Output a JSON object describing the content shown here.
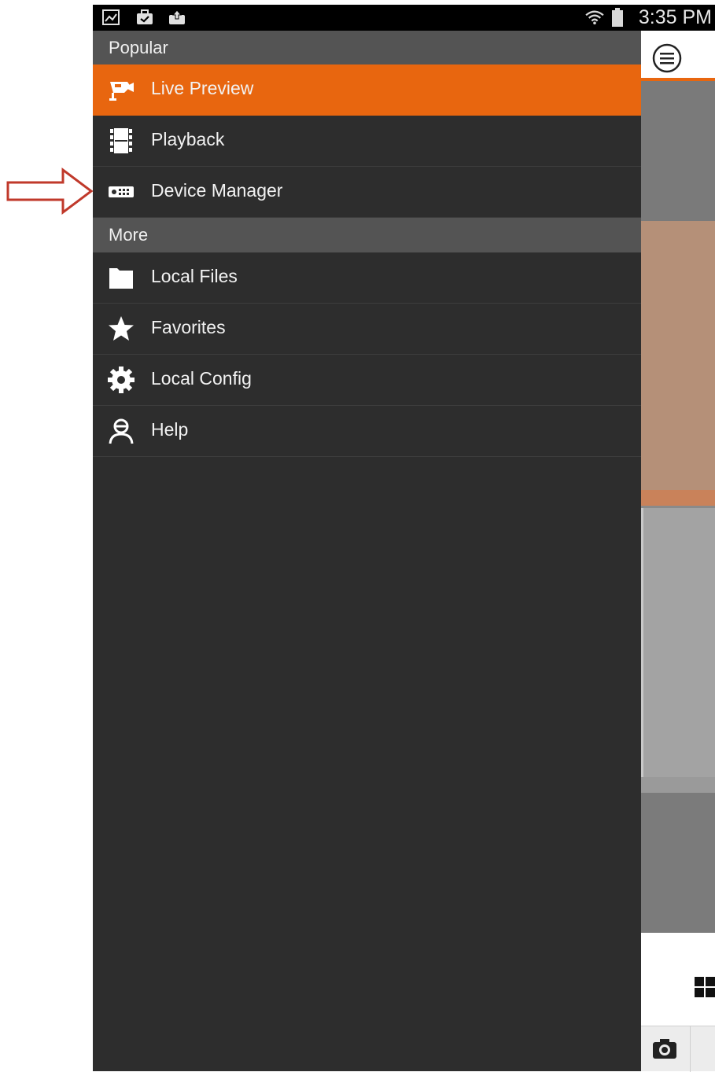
{
  "status_bar": {
    "time": "3:35 PM",
    "left_icons": [
      "gallery-icon",
      "briefcase-check-icon",
      "briefcase-upload-icon"
    ],
    "right_icons": [
      "wifi-icon",
      "battery-icon"
    ]
  },
  "drawer": {
    "sections": [
      {
        "header": "Popular",
        "items": [
          {
            "label": "Live Preview",
            "icon": "cctv-camera-icon",
            "active": true
          },
          {
            "label": "Playback",
            "icon": "film-strip-icon",
            "active": false
          },
          {
            "label": "Device Manager",
            "icon": "device-recorder-icon",
            "active": false
          }
        ]
      },
      {
        "header": "More",
        "items": [
          {
            "label": "Local Files",
            "icon": "folder-icon",
            "active": false
          },
          {
            "label": "Favorites",
            "icon": "star-icon",
            "active": false
          },
          {
            "label": "Local Config",
            "icon": "gear-icon",
            "active": false
          },
          {
            "label": "Help",
            "icon": "person-help-icon",
            "active": false
          }
        ]
      }
    ]
  },
  "right_panel": {
    "icons": [
      "hamburger-menu-icon",
      "grid-layout-icon",
      "camera-snapshot-icon"
    ]
  },
  "colors": {
    "accent": "#e8660f",
    "drawer_bg": "#2d2d2d",
    "section_header_bg": "#545454",
    "annotation_arrow": "#c0392b"
  }
}
